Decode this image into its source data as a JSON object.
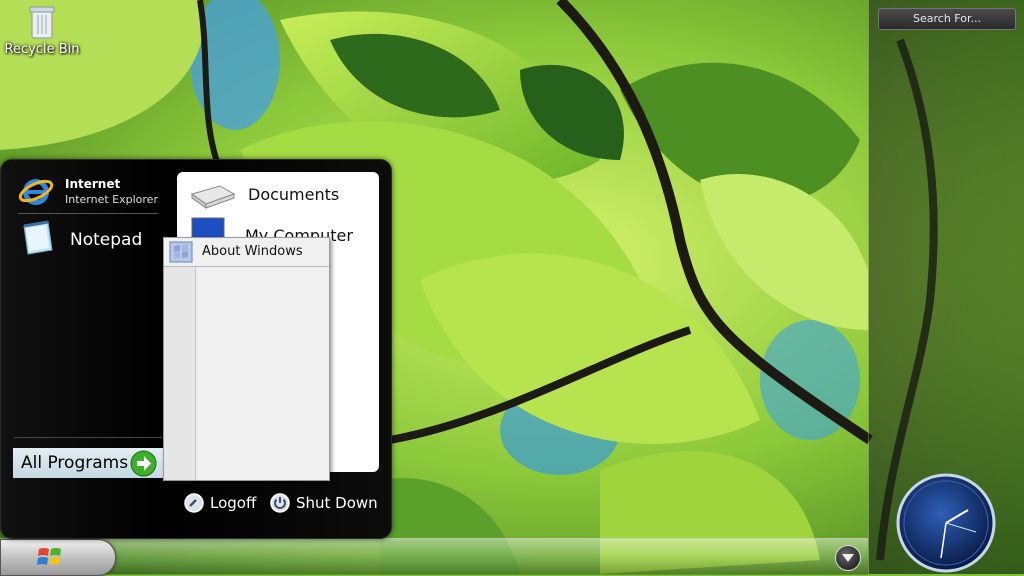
{
  "desktop": {
    "recycle_bin_label": "Recycle Bin"
  },
  "sidebar": {
    "search_label": "Search For..."
  },
  "start_menu": {
    "pinned": [
      {
        "title": "Internet",
        "subtitle": "Internet Explorer",
        "icon": "internet-explorer-icon"
      },
      {
        "title": "Notepad",
        "icon": "notepad-icon"
      }
    ],
    "all_programs_label": "All Programs",
    "places": [
      {
        "label": "Documents",
        "icon": "documents-icon"
      },
      {
        "label": "My Computer",
        "icon": "my-computer-icon"
      }
    ],
    "submenu": {
      "items": [
        {
          "label": "About Windows",
          "icon": "windows-flag-icon"
        }
      ]
    },
    "logoff_label": "Logoff",
    "shutdown_label": "Shut Down"
  },
  "colors": {
    "menu_bg": "#000000",
    "all_programs_bg": "#d6e4ec",
    "green_arrow": "#3fae2a",
    "clock_face": "#0d2a66"
  }
}
